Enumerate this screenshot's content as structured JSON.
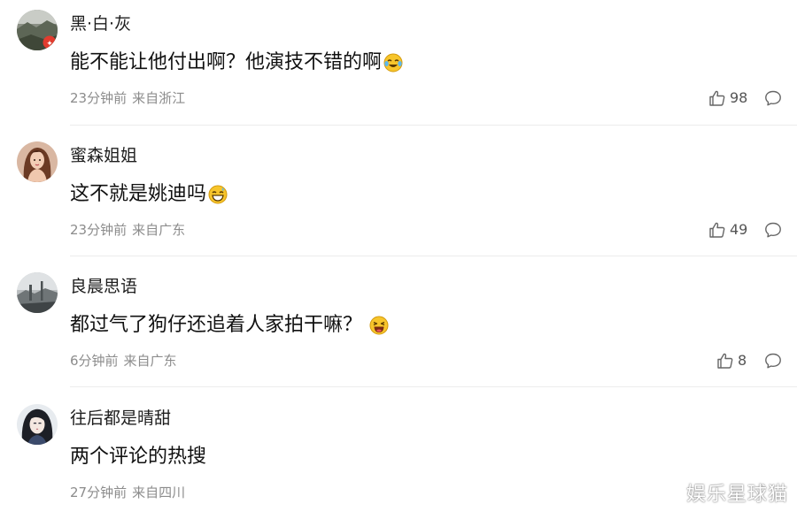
{
  "comments": [
    {
      "username": "黑·白·灰",
      "content": "能不能让他付出啊？他演技不错的啊",
      "emoji": "crying-laugh-emoji",
      "time": "23分钟前",
      "location": "来自浙江",
      "likes": "98",
      "avatar": "landscape-avatar-with-badge"
    },
    {
      "username": "蜜森姐姐",
      "content": "这不就是姚迪吗",
      "emoji": "grinning-sweat-emoji",
      "time": "23分钟前",
      "location": "来自广东",
      "likes": "49",
      "avatar": "woman-portrait-avatar"
    },
    {
      "username": "良晨思语",
      "content": "都过气了狗仔还追着人家拍干嘛？",
      "emoji": "laughing-emoji",
      "time": "6分钟前",
      "location": "来自广东",
      "likes": "8",
      "avatar": "grey-scenery-avatar"
    },
    {
      "username": "往后都是晴甜",
      "content": "两个评论的热搜",
      "emoji": "",
      "time": "27分钟前",
      "location": "来自四川",
      "likes": "",
      "avatar": "anime-girl-avatar"
    }
  ],
  "watermark": "娱乐星球猫",
  "colors": {
    "username": "#1e1e1e",
    "content": "#111111",
    "meta": "#8c8c8c",
    "divider": "#ececec",
    "icon": "#666666"
  }
}
